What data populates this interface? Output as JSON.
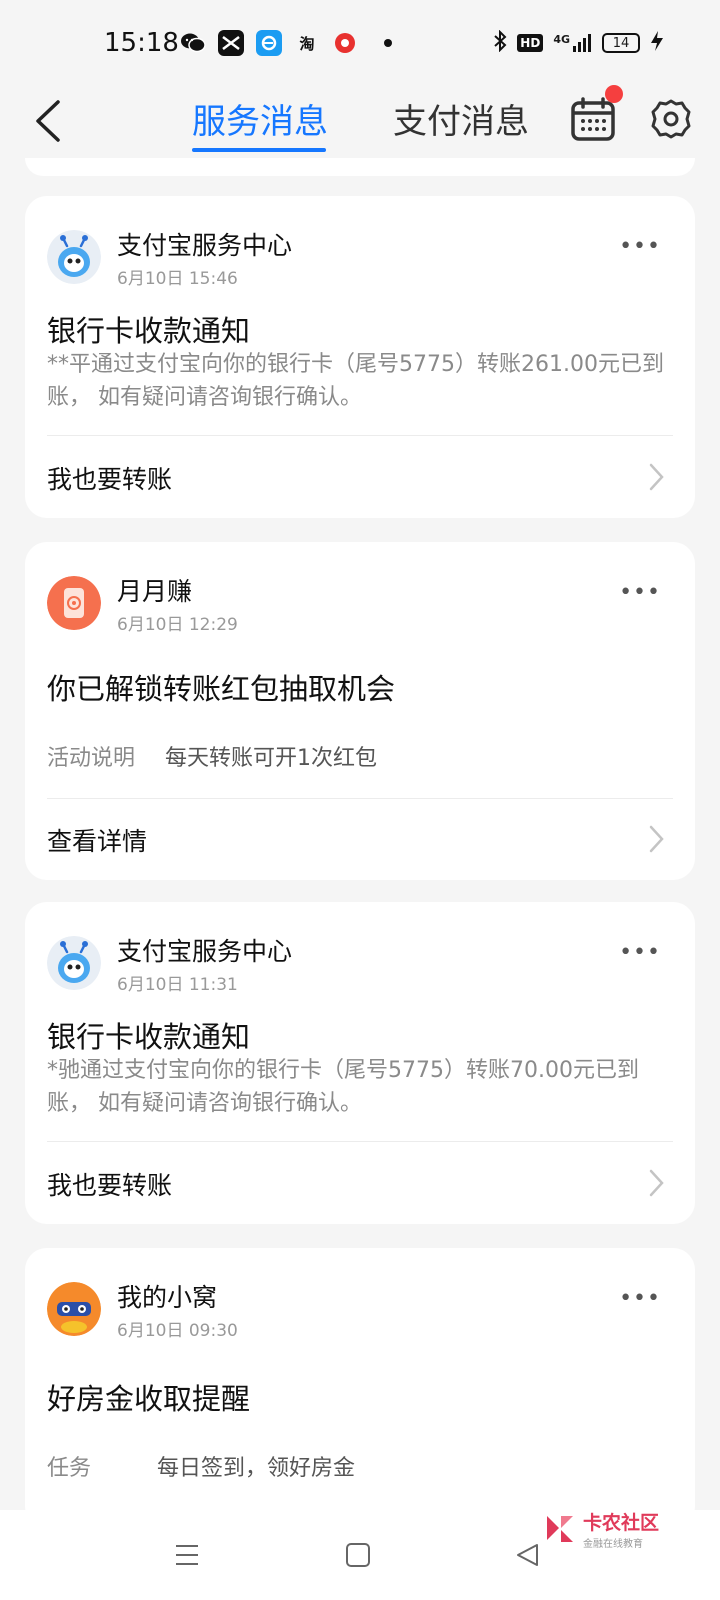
{
  "status_bar": {
    "time": "15:18",
    "apps": [
      "wechat-icon",
      "capcut-icon",
      "ele-icon",
      "taobao-icon",
      "record-icon"
    ],
    "taobao_label": "淘",
    "hd_label": "HD",
    "network_label": "4G",
    "battery_level": "14"
  },
  "header": {
    "tab_service": "服务消息",
    "tab_pay": "支付消息",
    "active_color": "#1677ff"
  },
  "cards": [
    {
      "sender": "支付宝服务中心",
      "time": "6月10日 15:46",
      "more": "•••",
      "title": "银行卡收款通知",
      "body": "**平通过支付宝向你的银行卡（尾号5775）转账261.00元已到账， 如有疑问请咨询银行确认。",
      "action": "我也要转账"
    },
    {
      "sender": "月月赚",
      "time": "6月10日 12:29",
      "more": "•••",
      "title": "你已解锁转账红包抽取机会",
      "row_label": "活动说明",
      "row_value": "每天转账可开1次红包",
      "action": "查看详情"
    },
    {
      "sender": "支付宝服务中心",
      "time": "6月10日 11:31",
      "more": "•••",
      "title": "银行卡收款通知",
      "body": "*驰通过支付宝向你的银行卡（尾号5775）转账70.00元已到账， 如有疑问请咨询银行确认。",
      "action": "我也要转账"
    },
    {
      "sender": "我的小窝",
      "time": "6月10日 09:30",
      "more": "•••",
      "title": "好房金收取提醒",
      "row_label": "任务",
      "row_value": "每日签到，领好房金"
    }
  ],
  "watermark": {
    "name": "卡农社区",
    "slogan": "金融在线教育"
  },
  "colors": {
    "accent": "#1677ff",
    "badge": "#f53f3f",
    "background": "#f5f5f5"
  }
}
